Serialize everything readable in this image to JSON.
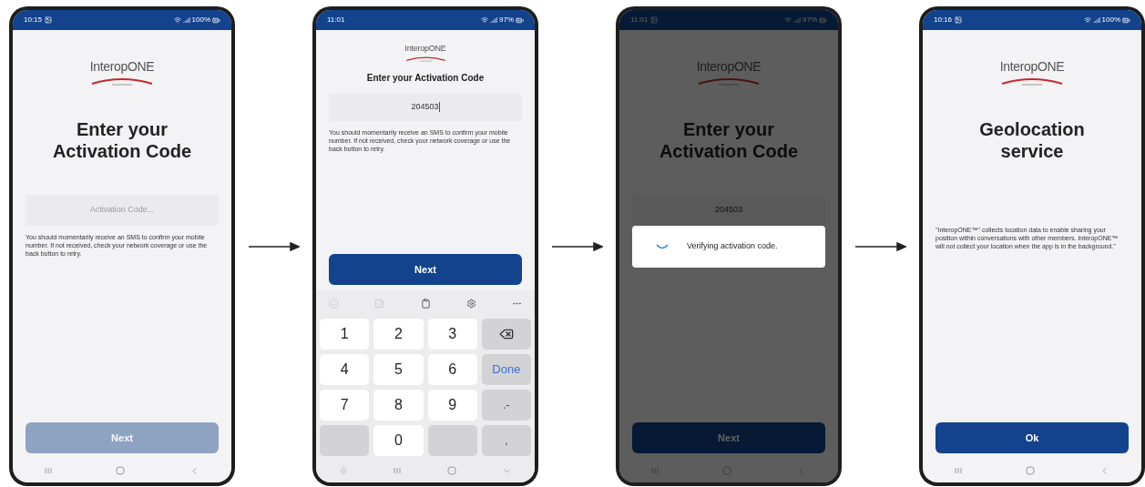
{
  "screens": [
    {
      "status_bar": {
        "time": "10:15",
        "notification": true,
        "battery": "100%"
      },
      "dimmed": false,
      "logo": "InteropONE",
      "title": "Enter your Activation Code",
      "field": {
        "placeholder": "Activation Code..."
      },
      "note": "You should momentarily receive an SMS to confirm your mobile number. If not received, check your network coverage or use the back button to retry.",
      "button": {
        "label": "Next",
        "disabled": true
      }
    },
    {
      "status_bar": {
        "time": "11:01",
        "notification": false,
        "battery": "97%"
      },
      "dimmed": false,
      "logo": "InteropONE",
      "title": "Enter your Activation Code",
      "field": {
        "value": "204503",
        "focused": true
      },
      "note": "You should momentarily receive an SMS to confirm your mobile number. If not received, check your network coverage or use the back button to retry.",
      "button": {
        "label": "Next",
        "disabled": false
      },
      "keyboard": {
        "toolbar": [
          {
            "kind": "emoji",
            "disabled": true
          },
          {
            "kind": "sticker",
            "disabled": true
          },
          {
            "kind": "clipboard",
            "disabled": false
          },
          {
            "kind": "settings",
            "disabled": false
          },
          {
            "kind": "more",
            "disabled": false
          }
        ],
        "rows": [
          [
            {
              "kind": "digit",
              "label": "1"
            },
            {
              "kind": "digit",
              "label": "2"
            },
            {
              "kind": "digit",
              "label": "3"
            },
            {
              "kind": "backspace"
            }
          ],
          [
            {
              "kind": "digit",
              "label": "4"
            },
            {
              "kind": "digit",
              "label": "5"
            },
            {
              "kind": "digit",
              "label": "6"
            },
            {
              "kind": "action",
              "label": "Done"
            }
          ],
          [
            {
              "kind": "digit",
              "label": "7"
            },
            {
              "kind": "digit",
              "label": "8"
            },
            {
              "kind": "digit",
              "label": "9"
            },
            {
              "kind": "symbol",
              "label": ".-"
            }
          ],
          [
            {
              "kind": "blank"
            },
            {
              "kind": "digit",
              "label": "0"
            },
            {
              "kind": "blank"
            },
            {
              "kind": "symbol",
              "label": ","
            }
          ]
        ]
      }
    },
    {
      "status_bar": {
        "time": "11:01",
        "notification": true,
        "battery": "97%"
      },
      "dimmed": true,
      "dialog": "Verifying activation code.",
      "logo": "InteropONE",
      "title": "Enter your Activation Code",
      "field": {
        "value": "204503",
        "focused": false
      },
      "button": {
        "label": "Next",
        "disabled": false
      }
    },
    {
      "status_bar": {
        "time": "10:16",
        "notification": true,
        "battery": "100%"
      },
      "dimmed": false,
      "logo": "InteropONE",
      "title": "Geolocation service",
      "note": "\"InteropONE™\" collects location data to enable sharing your position within conversations with other members. InteropONE™ will not collect your location when the app is in the background.\"",
      "button": {
        "label": "Ok",
        "disabled": false
      }
    }
  ]
}
